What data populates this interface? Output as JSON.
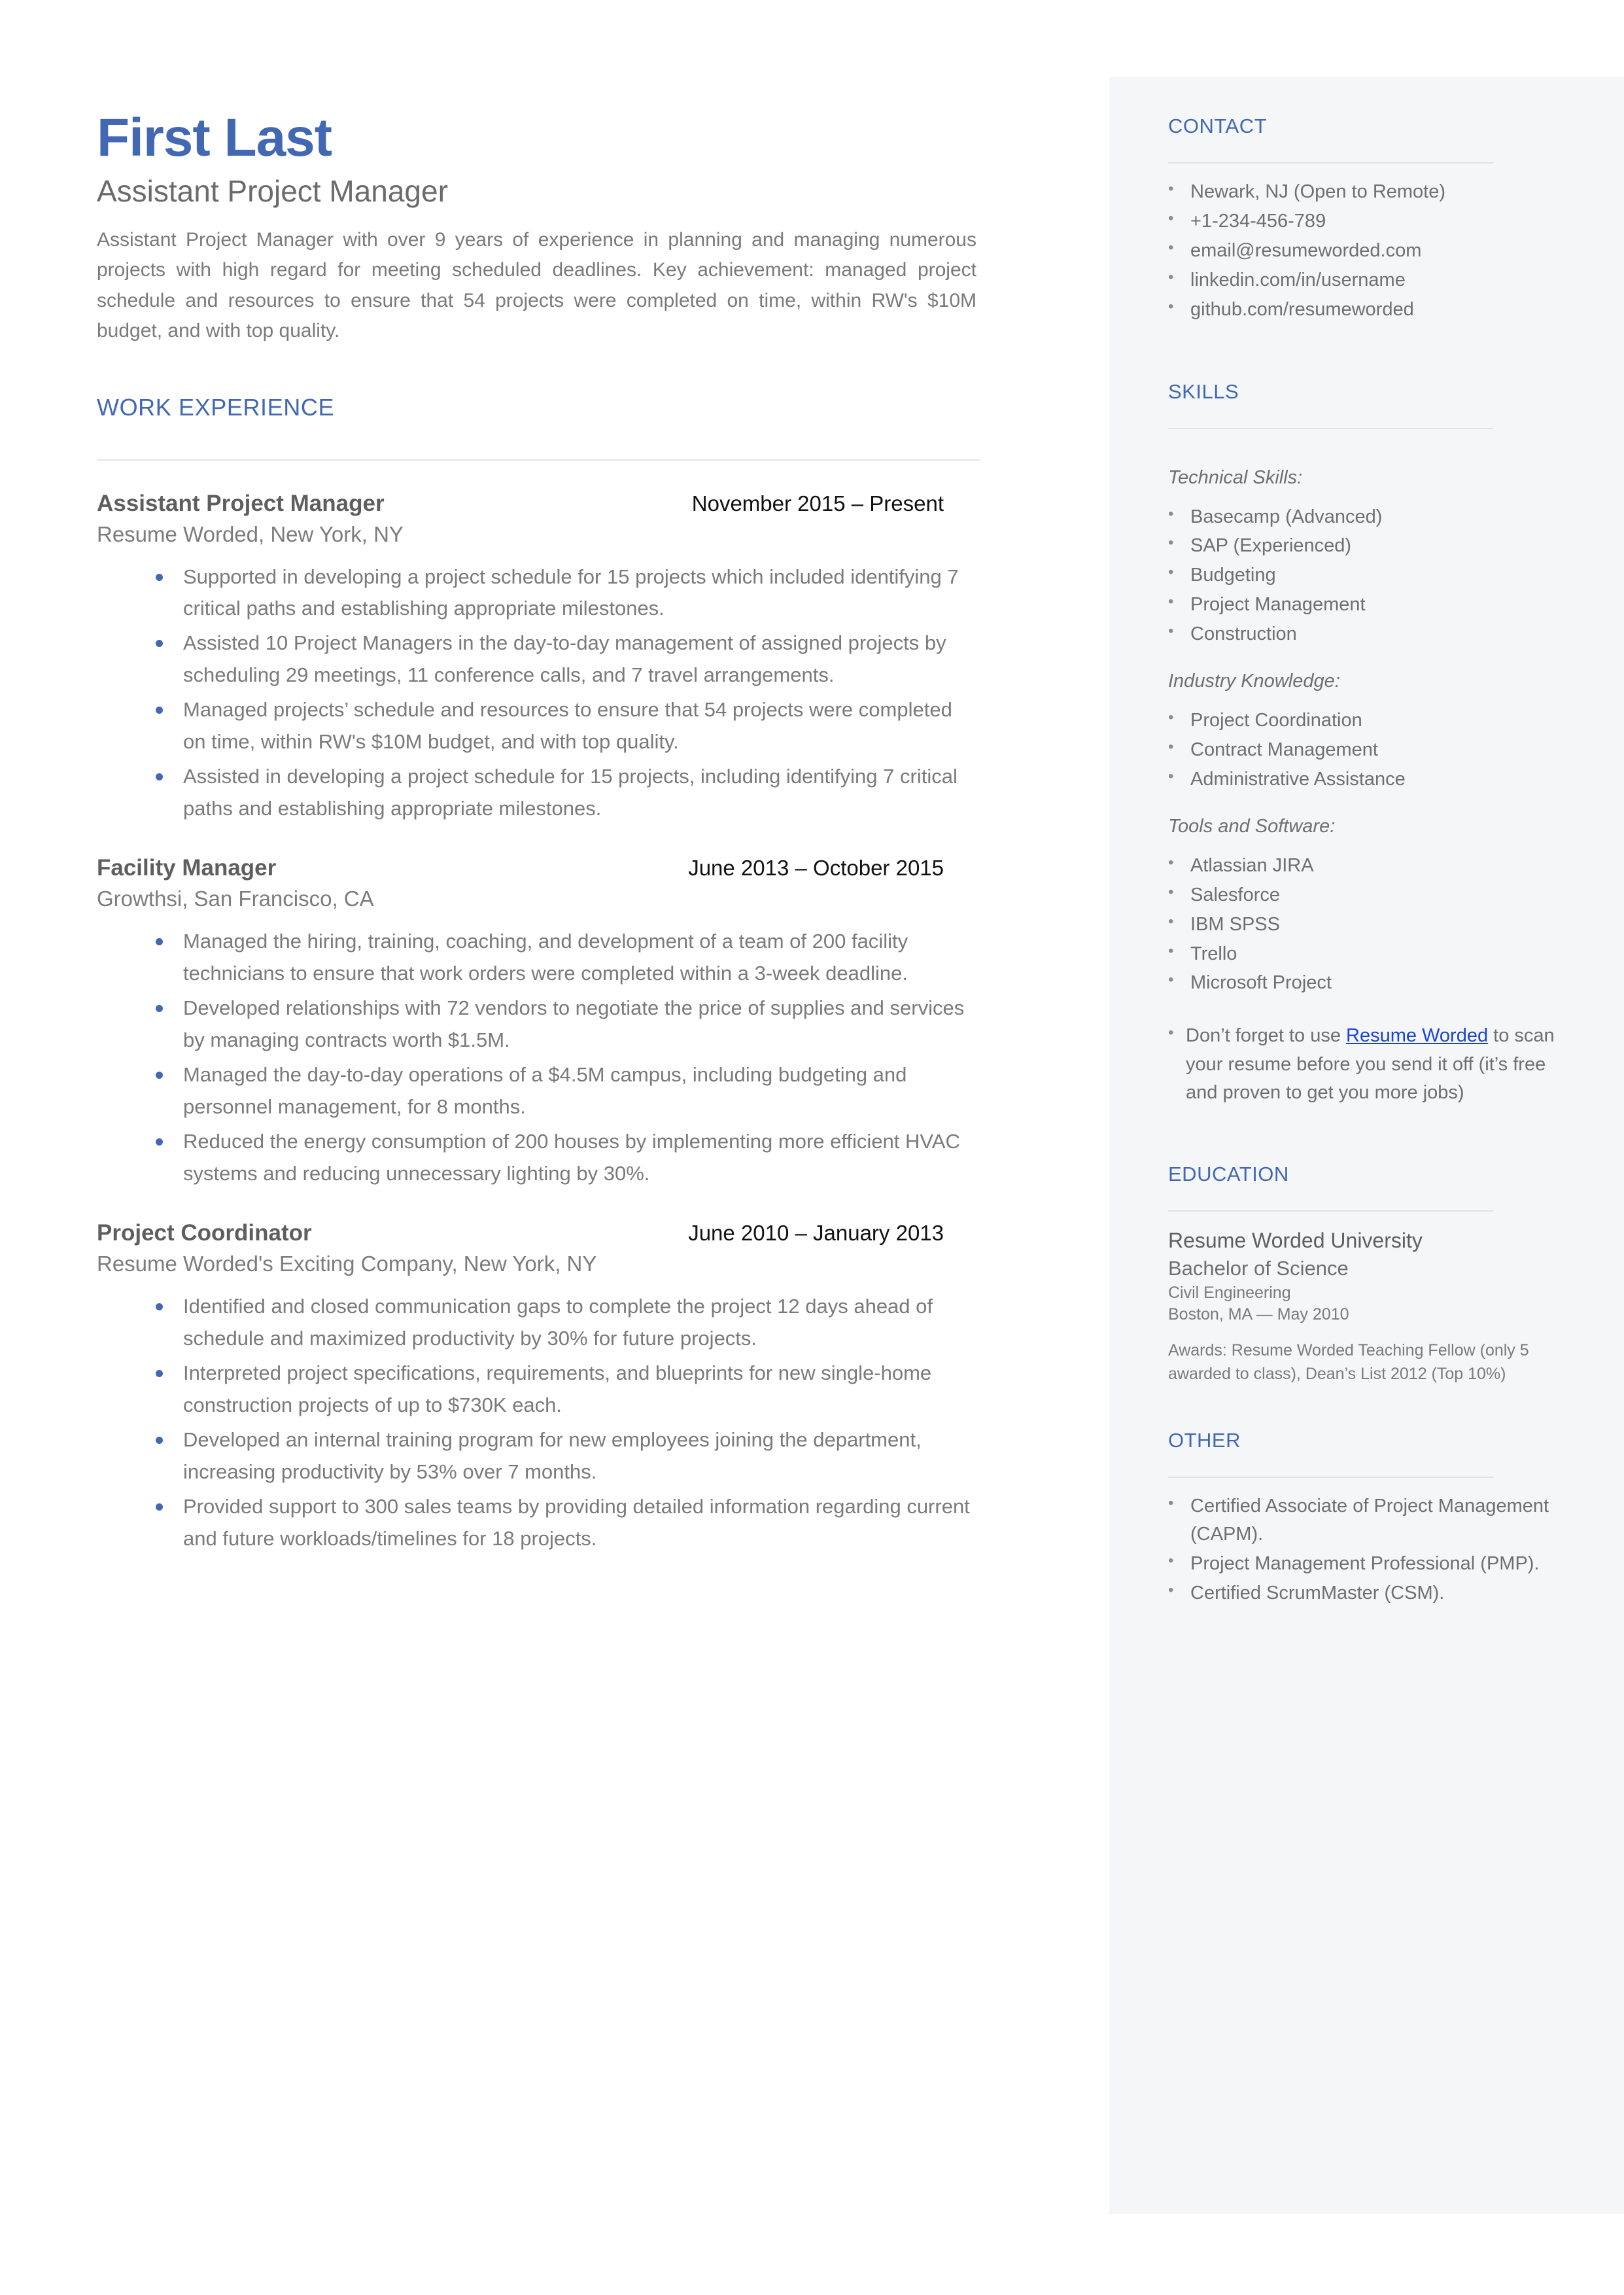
{
  "colors": {
    "accent": "#4268b3",
    "sidebar_bg": "#f4f6f8",
    "body_text": "#7a7a7a",
    "link": "#1a42d8"
  },
  "header": {
    "name": "First Last",
    "headline": "Assistant Project Manager",
    "summary": "Assistant Project Manager with over 9 years of experience in planning and managing numerous projects with high regard for meeting scheduled deadlines. Key achievement: managed project schedule and resources to ensure that 54 projects were completed on time, within RW's $10M budget, and with top quality."
  },
  "work_experience": {
    "heading": "WORK EXPERIENCE",
    "jobs": [
      {
        "title": "Assistant Project Manager",
        "dates": "November 2015 – Present",
        "company": "Resume Worded, New York, NY",
        "bullets": [
          "Supported in developing a project schedule for 15 projects which included identifying 7 critical paths and establishing appropriate milestones.",
          "Assisted 10 Project Managers in the day-to-day management of assigned projects by scheduling 29 meetings, 11 conference calls, and 7 travel arrangements.",
          "Managed projects’ schedule and resources to ensure that 54 projects were completed on time, within RW's $10M budget, and with top quality.",
          "Assisted in developing a project schedule for 15 projects, including identifying 7 critical paths and establishing appropriate milestones."
        ]
      },
      {
        "title": "Facility Manager",
        "dates": "June 2013 – October 2015",
        "company": "Growthsi, San Francisco, CA",
        "bullets": [
          "Managed the hiring, training, coaching, and development of a team of 200 facility technicians to ensure that work orders were completed within a 3-week deadline.",
          "Developed relationships with 72 vendors to negotiate the price of supplies and services by managing contracts worth $1.5M.",
          "Managed the day-to-day operations of a $4.5M campus, including budgeting and personnel management, for 8 months.",
          "Reduced the energy consumption of 200 houses by implementing more efficient HVAC systems and reducing unnecessary lighting by 30%."
        ]
      },
      {
        "title": "Project Coordinator",
        "dates": "June 2010 – January 2013",
        "company": "Resume Worded's Exciting Company, New York, NY",
        "bullets": [
          "Identified and closed communication gaps to complete the project 12 days ahead of schedule and maximized productivity by 30% for future projects.",
          "Interpreted project specifications, requirements, and blueprints for new single-home construction projects of up to $730K each.",
          "Developed an internal training program for new employees joining the department, increasing productivity by 53% over 7 months.",
          "Provided support to 300 sales teams by providing detailed information regarding current and future workloads/timelines for 18 projects."
        ]
      }
    ]
  },
  "sidebar": {
    "contact": {
      "heading": "CONTACT",
      "items": [
        "Newark, NJ (Open to Remote)",
        "+1-234-456-789",
        "email@resumeworded.com",
        "linkedin.com/in/username",
        "github.com/resumeworded"
      ]
    },
    "skills": {
      "heading": "SKILLS",
      "groups": [
        {
          "label": "Technical Skills:",
          "items": [
            "Basecamp (Advanced)",
            "SAP (Experienced)",
            "Budgeting",
            "Project Management",
            "Construction"
          ]
        },
        {
          "label": "Industry Knowledge:",
          "items": [
            "Project Coordination",
            "Contract Management",
            "Administrative Assistance"
          ]
        },
        {
          "label": "Tools and Software:",
          "items": [
            "Atlassian JIRA",
            "Salesforce",
            "IBM SPSS",
            "Trello",
            "Microsoft Project"
          ]
        }
      ],
      "promo": {
        "prefix": "Don’t forget to use ",
        "link_text": "Resume Worded",
        "suffix": " to scan your resume before you send it off (it’s free and proven to get you more jobs)"
      }
    },
    "education": {
      "heading": "EDUCATION",
      "school": "Resume Worded University",
      "degree": "Bachelor of Science",
      "field": "Civil Engineering",
      "place": "Boston, MA — May 2010",
      "awards": "Awards: Resume Worded Teaching Fellow (only 5 awarded to class), Dean’s List 2012 (Top 10%)"
    },
    "other": {
      "heading": "OTHER",
      "items": [
        "Certified Associate of Project Management (CAPM).",
        "Project Management Professional (PMP).",
        "Certified ScrumMaster (CSM)."
      ]
    }
  }
}
